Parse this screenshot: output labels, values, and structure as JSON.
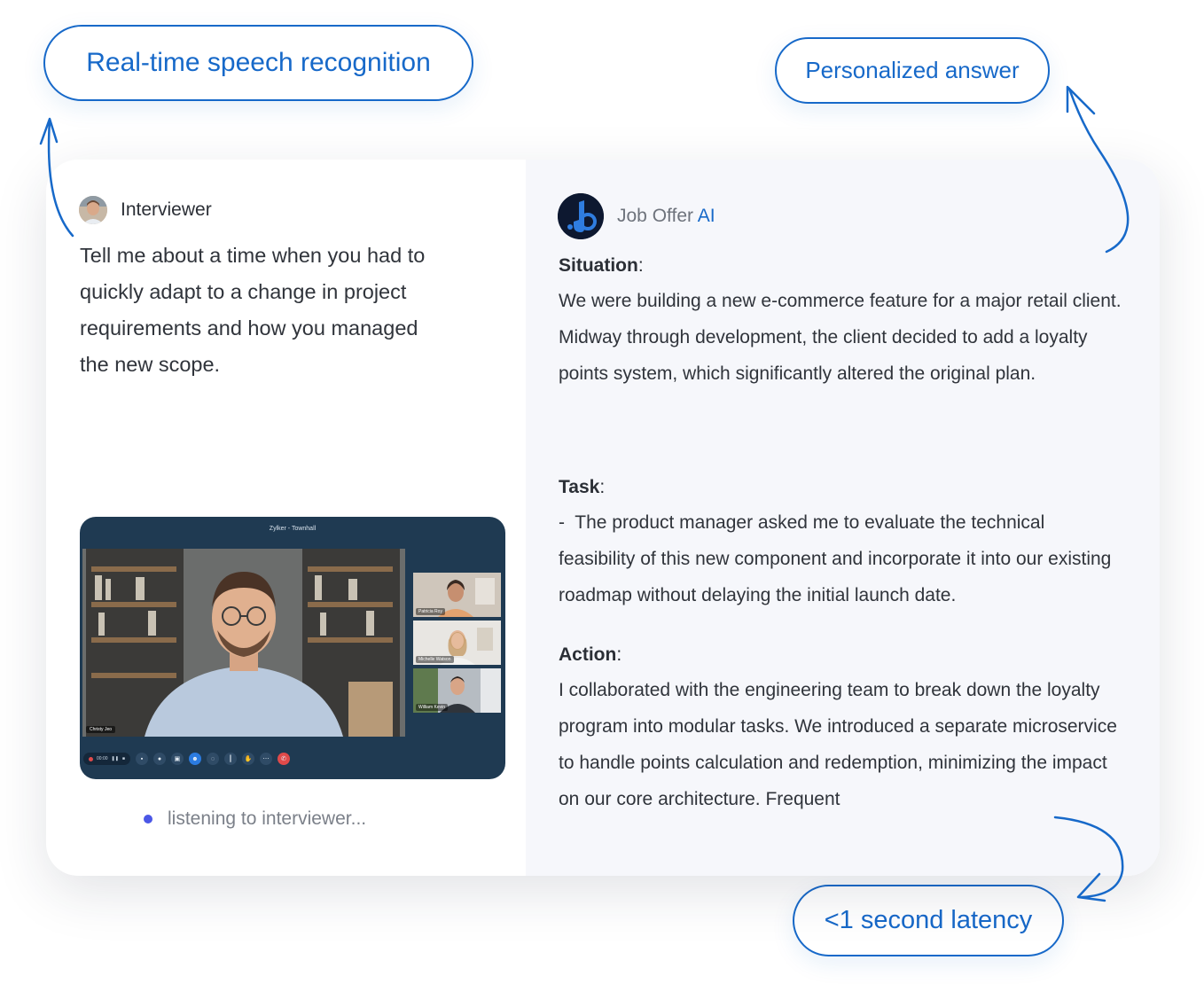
{
  "callouts": {
    "speech": "Real-time speech recognition",
    "personalized": "Personalized answer",
    "latency": "<1 second latency"
  },
  "interviewer": {
    "name": "Interviewer",
    "question": "Tell me about a time when you had to quickly adapt to a change in project requirements and how you managed the new scope."
  },
  "video_call": {
    "title": "Zylker - Townhall",
    "main_participant": "Christy Jeo",
    "timer": "00:00",
    "participants": [
      "Patricia Roy",
      "Michelle Watson",
      "William Kevin"
    ]
  },
  "status": {
    "listening": "listening to interviewer..."
  },
  "ai": {
    "name_prefix": "Job Offer",
    "name_accent": "AI",
    "accent_color": "#1769c9"
  },
  "answer": {
    "situation_title": "Situation",
    "situation_text": "We were building a new e-commerce feature for a major retail client. Midway through development, the client decided to add a loyalty points system, which significantly altered the original plan.",
    "task_title": "Task",
    "task_text": "-  The product manager asked me to evaluate the technical feasibility of this new component and incorporate it into our existing roadmap without delaying the initial launch date.",
    "action_title": "Action",
    "action_text": "I collaborated with the engineering team to break down the loyalty program into modular tasks. We introduced a separate microservice to handle points calculation and redemption, minimizing the impact on our core architecture. Frequent"
  }
}
